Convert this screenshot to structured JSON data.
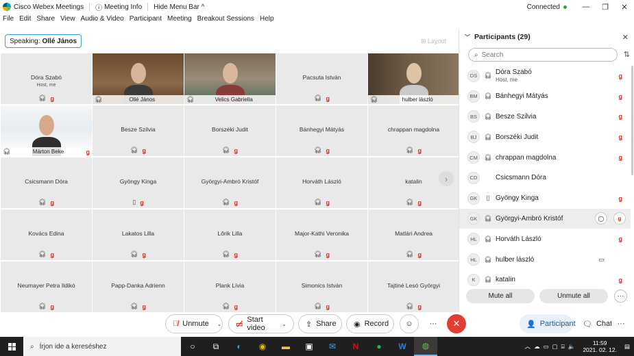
{
  "titlebar": {
    "app_name": "Cisco Webex Meetings",
    "meeting_info": "Meeting Info",
    "hide_menu_bar": "Hide Menu Bar ^",
    "status": "Connected",
    "status_color": "#2ea043"
  },
  "menu": [
    "File",
    "Edit",
    "Share",
    "View",
    "Audio & Video",
    "Participant",
    "Meeting",
    "Breakout Sessions",
    "Help"
  ],
  "speaking": {
    "label": "Speaking:",
    "name": "Ollé János"
  },
  "layout_label": "Layout",
  "grid": {
    "tiles": [
      {
        "name": "Dóra Szabó",
        "sub": "Host, me",
        "video": false
      },
      {
        "name": "Ollé János",
        "video": true,
        "active": true
      },
      {
        "name": "Velics Gabriella",
        "video": true
      },
      {
        "name": "Pacsuta István",
        "video": false
      },
      {
        "name": "hulber lászló",
        "video": true
      },
      {
        "name": "Márton Beke",
        "video": true
      },
      {
        "name": "Besze Szilvia",
        "video": false
      },
      {
        "name": "Borszéki Judit",
        "video": false
      },
      {
        "name": "Bánhegyi Mátyás",
        "video": false
      },
      {
        "name": "chrappan magdolna",
        "video": false
      },
      {
        "name": "Csicsmann Dóra",
        "video": false
      },
      {
        "name": "Gyöngy Kinga",
        "video": false,
        "device": "phone"
      },
      {
        "name": "Györgyi-Ambró Kristóf",
        "video": false
      },
      {
        "name": "Horváth László",
        "video": false
      },
      {
        "name": "katalin",
        "video": false
      },
      {
        "name": "Kovács Edina",
        "video": false
      },
      {
        "name": "Lakatos Lilla",
        "video": false
      },
      {
        "name": "Lőrik Lilla",
        "video": false
      },
      {
        "name": "Major-Kathi Veronika",
        "video": false
      },
      {
        "name": "Matlári Andrea",
        "video": false
      },
      {
        "name": "Neumayer Petra Ildikó",
        "video": false
      },
      {
        "name": "Papp-Danka Adrienn",
        "video": false
      },
      {
        "name": "Plank Lívia",
        "video": false
      },
      {
        "name": "Simonics István",
        "video": false
      },
      {
        "name": "Tajtiné Lesó Györgyi",
        "video": false
      }
    ]
  },
  "participants": {
    "title": "Participants (29)",
    "search_placeholder": "Search",
    "list": [
      {
        "initials": "DS",
        "name": "Dóra Szabó",
        "sub": "Host, me",
        "muted": true
      },
      {
        "initials": "BM",
        "name": "Bánhegyi Mátyás",
        "muted": true
      },
      {
        "initials": "BS",
        "name": "Besze Szilvia",
        "muted": true
      },
      {
        "initials": "BJ",
        "name": "Borszéki Judit",
        "muted": true
      },
      {
        "initials": "CM",
        "name": "chrappan magdolna",
        "muted": true
      },
      {
        "initials": "CD",
        "name": "Csicsmann Dóra",
        "muted": false
      },
      {
        "initials": "GK",
        "name": "Gyöngy Kinga",
        "muted": true,
        "device": "phone"
      },
      {
        "initials": "GK",
        "name": "Györgyi-Ambró Kristóf",
        "muted": true,
        "hover": true
      },
      {
        "initials": "HL",
        "name": "Horváth László",
        "muted": true
      },
      {
        "initials": "HL",
        "name": "hulber lászló",
        "muted": false,
        "camera": true
      },
      {
        "initials": "K",
        "name": "katalin",
        "muted": true
      }
    ],
    "mute_all": "Mute all",
    "unmute_all": "Unmute all"
  },
  "controls": {
    "unmute": "Unmute",
    "start_video": "Start video",
    "share": "Share",
    "record": "Record",
    "participants": "Participants",
    "chat": "Chat"
  },
  "taskbar": {
    "search_placeholder": "Írjon ide a kereséshez",
    "time": "11:59",
    "date": "2021. 02. 12."
  }
}
